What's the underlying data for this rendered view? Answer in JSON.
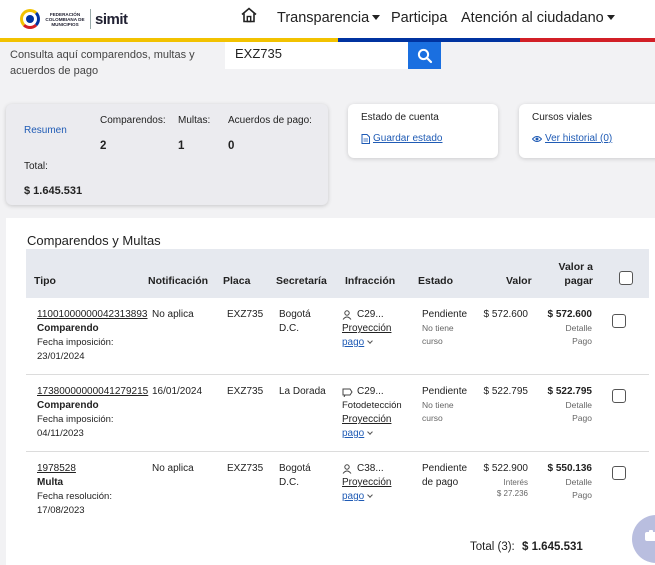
{
  "header": {
    "logo_org": "FEDERACIÓN COLOMBIANA DE MUNICIPIOS",
    "logo_brand": "simit",
    "nav": [
      {
        "label": "Transparencia"
      },
      {
        "label": "Participa"
      },
      {
        "label": "Atención al ciudadano"
      }
    ],
    "colors": {
      "yellow": "#f2c200",
      "blue": "#0033a0",
      "red": "#d21f26"
    }
  },
  "search": {
    "label": "Consulta aquí comparendos, multas y acuerdos de pago",
    "value": "EXZ735"
  },
  "summary": {
    "resumen": "Resumen",
    "comparendos_label": "Comparendos:",
    "comparendos_value": "2",
    "multas_label": "Multas:",
    "multas_value": "1",
    "acuerdos_label": "Acuerdos de pago:",
    "acuerdos_value": "0",
    "total_label": "Total:",
    "total_value": "$ 1.645.531"
  },
  "estado": {
    "title": "Estado de cuenta",
    "link": "Guardar estado"
  },
  "cursos": {
    "title": "Cursos viales",
    "link": "Ver historial (0)"
  },
  "table": {
    "title": "Comparendos y Multas",
    "headers": {
      "tipo": "Tipo",
      "notificacion": "Notificación",
      "placa": "Placa",
      "secretaria": "Secretaría",
      "infraccion": "Infracción",
      "estado": "Estado",
      "valor": "Valor",
      "valor_pagar_1": "Valor a",
      "valor_pagar_2": "pagar"
    },
    "rows": [
      {
        "numero": "11001000000042313893",
        "tipo": "Comparendo",
        "fecha_label": "Fecha imposición:",
        "fecha": "23/01/2024",
        "notificacion": "No aplica",
        "placa": "EXZ735",
        "secretaria_1": "Bogotá",
        "secretaria_2": "D.C.",
        "infraccion": "C29...",
        "deteccion": "",
        "proyeccion_1": "Proyección",
        "proyeccion_2": "pago",
        "estado_1": "Pendiente",
        "estado_2": "No tiene",
        "estado_3": "curso",
        "valor": "$ 572.600",
        "interes_label": "",
        "interes": "",
        "valor_pagar": "$ 572.600",
        "detalle_1": "Detalle",
        "detalle_2": "Pago"
      },
      {
        "numero": "17380000000041279215",
        "tipo": "Comparendo",
        "fecha_label": "Fecha imposición:",
        "fecha": "04/11/2023",
        "notificacion": "16/01/2024",
        "placa": "EXZ735",
        "secretaria_1": "La Dorada",
        "secretaria_2": "",
        "infraccion": "C29...",
        "deteccion": "Fotodetección",
        "proyeccion_1": "Proyección",
        "proyeccion_2": "pago",
        "estado_1": "Pendiente",
        "estado_2": "No tiene",
        "estado_3": "curso",
        "valor": "$ 522.795",
        "interes_label": "",
        "interes": "",
        "valor_pagar": "$ 522.795",
        "detalle_1": "Detalle",
        "detalle_2": "Pago"
      },
      {
        "numero": "1978528",
        "tipo": "Multa",
        "fecha_label": "Fecha resolución:",
        "fecha": "17/08/2023",
        "notificacion": "No aplica",
        "placa": "EXZ735",
        "secretaria_1": "Bogotá",
        "secretaria_2": "D.C.",
        "infraccion": "C38...",
        "deteccion": "",
        "proyeccion_1": "Proyección",
        "proyeccion_2": "pago",
        "estado_1": "Pendiente",
        "estado_2": "de pago",
        "estado_3": "",
        "valor": "$ 522.900",
        "interes_label": "Interés",
        "interes": "$ 27.236",
        "valor_pagar": "$ 550.136",
        "detalle_1": "Detalle",
        "detalle_2": "Pago"
      }
    ],
    "total_label": "Total (3):",
    "total_value": "$ 1.645.531"
  }
}
